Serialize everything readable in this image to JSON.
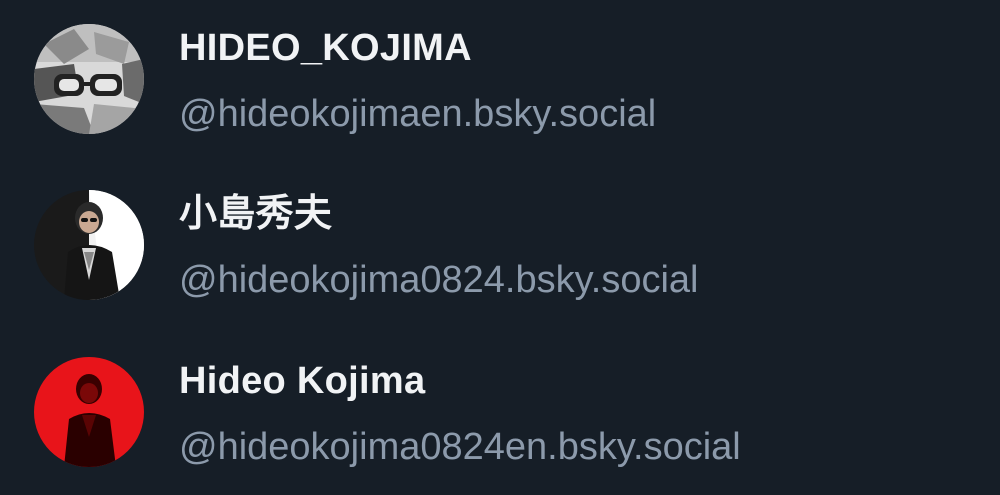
{
  "accounts": [
    {
      "display_name": "HIDEO_KOJIMA",
      "handle": "@hideokojimaen.bsky.social",
      "avatar_icon": "avatar-bw-photo"
    },
    {
      "display_name": "小島秀夫",
      "handle": "@hideokojima0824.bsky.social",
      "avatar_icon": "avatar-suit-photo"
    },
    {
      "display_name": "Hideo Kojima",
      "handle": "@hideokojima0824en.bsky.social",
      "avatar_icon": "avatar-red-photo"
    }
  ],
  "colors": {
    "background": "#161e27",
    "name": "#f1f3f5",
    "handle": "#8c9aab",
    "red_avatar": "#e8141a"
  }
}
